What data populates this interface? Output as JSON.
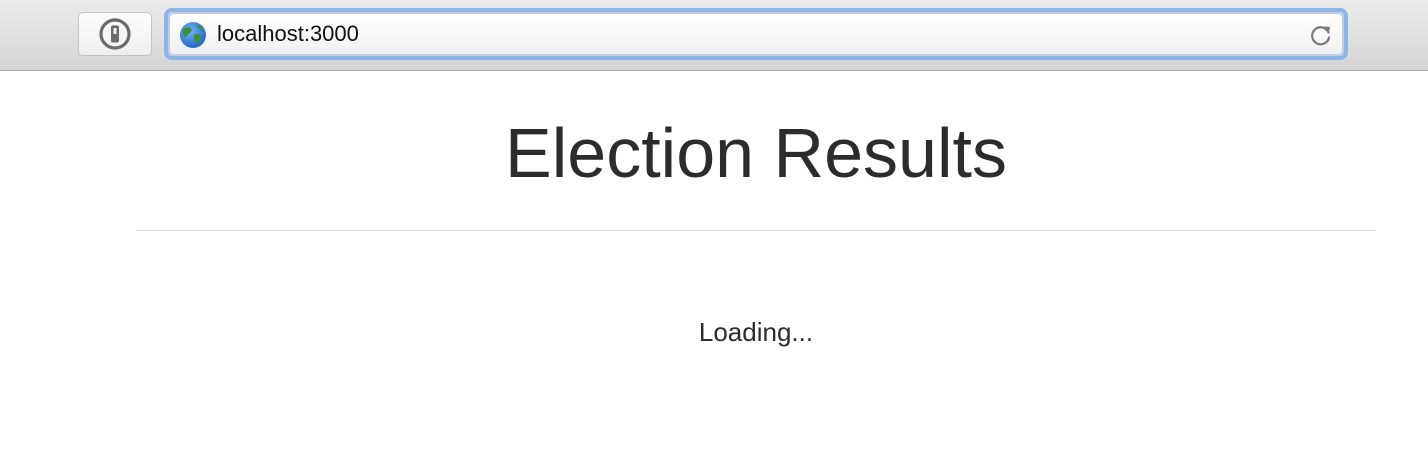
{
  "browser": {
    "password_manager_icon": "key-lock-icon",
    "address_bar": {
      "site_icon": "globe-icon",
      "url": "localhost:3000",
      "reload_icon": "reload-icon"
    },
    "colors": {
      "focus_ring": "#8cb6ea"
    }
  },
  "page": {
    "title": "Election Results",
    "status": "Loading..."
  }
}
